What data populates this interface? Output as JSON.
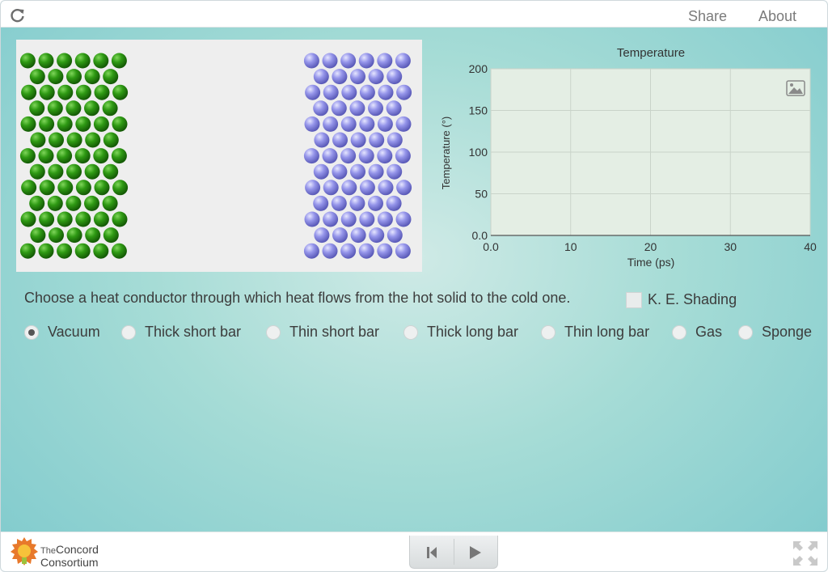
{
  "header": {
    "share_label": "Share",
    "about_label": "About",
    "reload_icon": "reload-icon"
  },
  "graph": {
    "title": "Temperature",
    "xlabel": "Time (ps)",
    "ylabel": "Temperature (°)",
    "x_ticks": [
      "0.0",
      "10",
      "20",
      "30",
      "40"
    ],
    "y_ticks": [
      "200",
      "150",
      "100",
      "50",
      "0.0"
    ]
  },
  "chart_data": {
    "type": "line",
    "title": "Temperature",
    "xlabel": "Time (ps)",
    "ylabel": "Temperature (°)",
    "xlim": [
      0,
      40
    ],
    "ylim": [
      0,
      200
    ],
    "grid": true,
    "series": []
  },
  "model": {
    "hot_color": "#2e8b12",
    "cold_color": "#8a8ae6"
  },
  "controls": {
    "instruction": "Choose a heat conductor through which heat flows from the hot solid to the cold one.",
    "ke_shading_label": "K. E. Shading",
    "ke_shading_checked": false,
    "conductors": [
      {
        "label": "Vacuum",
        "selected": true
      },
      {
        "label": "Thick short bar",
        "selected": false
      },
      {
        "label": "Thin short bar",
        "selected": false
      },
      {
        "label": "Thick long bar",
        "selected": false
      },
      {
        "label": "Thin long bar",
        "selected": false
      },
      {
        "label": "Gas",
        "selected": false
      },
      {
        "label": "Sponge",
        "selected": false
      }
    ]
  },
  "footer": {
    "logo_line1": "The",
    "logo_line1b": "Concord",
    "logo_line2": "Consortium"
  }
}
